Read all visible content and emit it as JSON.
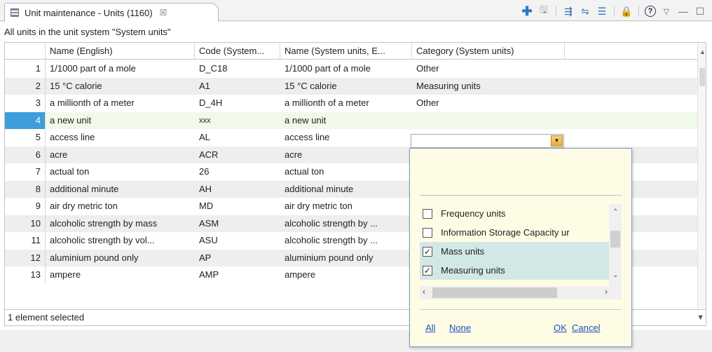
{
  "tab": {
    "title": "Unit maintenance - Units (1160)",
    "close": "☒"
  },
  "toolbar": {
    "add": "✚",
    "save": "🖫",
    "t1": "⇶",
    "t2": "⇋",
    "t3": "☰",
    "lock": "🔒",
    "help": "?",
    "menu": "▽",
    "min": "—",
    "max": "☐"
  },
  "description": "All units in the unit system \"System units\"",
  "columns": [
    "",
    "Name (English)",
    "Code (System...",
    "Name (System units, E...",
    "Category (System units)",
    ""
  ],
  "rows": [
    {
      "n": "1",
      "name": "1/1000 part of a mole",
      "code": "D_C18",
      "sname": "1/1000 part of a mole",
      "cat": "Other"
    },
    {
      "n": "2",
      "name": "15 °C calorie",
      "code": "A1",
      "sname": "15 °C calorie",
      "cat": "Measuring units"
    },
    {
      "n": "3",
      "name": "a millionth of a meter",
      "code": "D_4H",
      "sname": "a millionth of a meter",
      "cat": "Other"
    },
    {
      "n": "4",
      "name": "a new unit",
      "code": "xxx",
      "sname": "a new unit",
      "cat": ""
    },
    {
      "n": "5",
      "name": "access line",
      "code": "AL",
      "sname": "access line",
      "cat": ""
    },
    {
      "n": "6",
      "name": "acre",
      "code": "ACR",
      "sname": "acre",
      "cat": ""
    },
    {
      "n": "7",
      "name": "actual ton",
      "code": "26",
      "sname": "actual ton",
      "cat": ""
    },
    {
      "n": "8",
      "name": "additional minute",
      "code": "AH",
      "sname": "additional minute",
      "cat": ""
    },
    {
      "n": "9",
      "name": "air dry metric ton",
      "code": "MD",
      "sname": "air dry metric ton",
      "cat": ""
    },
    {
      "n": "10",
      "name": "alcoholic strength by mass",
      "code": "ASM",
      "sname": "alcoholic strength by ...",
      "cat": ""
    },
    {
      "n": "11",
      "name": "alcoholic strength by vol...",
      "code": "ASU",
      "sname": "alcoholic strength by ...",
      "cat": ""
    },
    {
      "n": "12",
      "name": "aluminium pound only",
      "code": "AP",
      "sname": "aluminium pound only",
      "cat": ""
    },
    {
      "n": "13",
      "name": "ampere",
      "code": "AMP",
      "sname": "ampere",
      "cat": ""
    }
  ],
  "status": "1 element selected",
  "popup": {
    "items": [
      {
        "label": "Frequency units",
        "checked": "",
        "on": false
      },
      {
        "label": "Information Storage Capacity ur",
        "checked": "",
        "on": false
      },
      {
        "label": "Mass units",
        "checked": "✓",
        "on": true
      },
      {
        "label": "Measuring units",
        "checked": "✓",
        "on": true
      }
    ],
    "all": "All",
    "none": "None",
    "ok": "OK",
    "cancel": "Cancel"
  }
}
